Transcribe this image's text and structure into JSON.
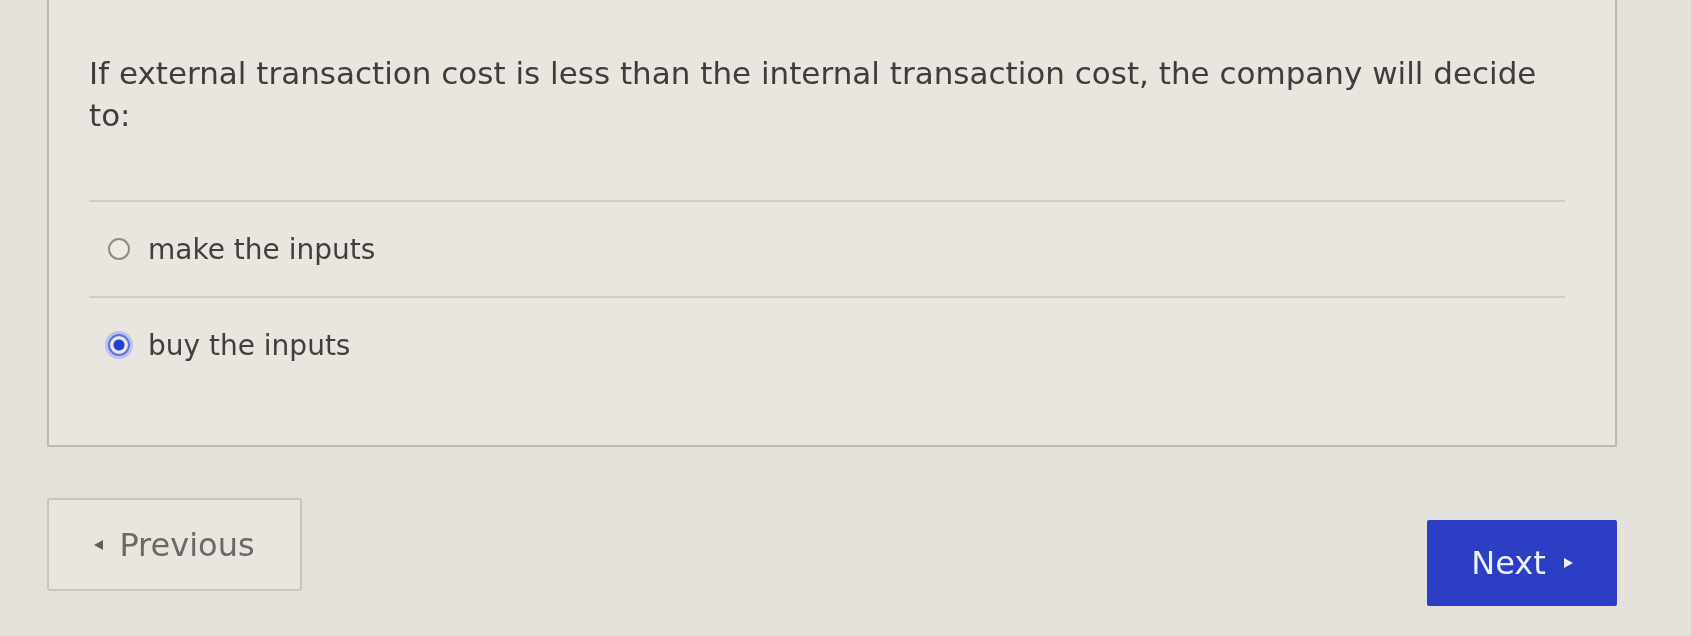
{
  "question": {
    "text": "If external transaction cost is less than the internal transaction cost, the company will decide to:"
  },
  "options": [
    {
      "label": "make the inputs",
      "selected": false
    },
    {
      "label": "buy the inputs",
      "selected": true
    }
  ],
  "navigation": {
    "previous": {
      "label": "Previous"
    },
    "next": {
      "label": "Next"
    }
  }
}
